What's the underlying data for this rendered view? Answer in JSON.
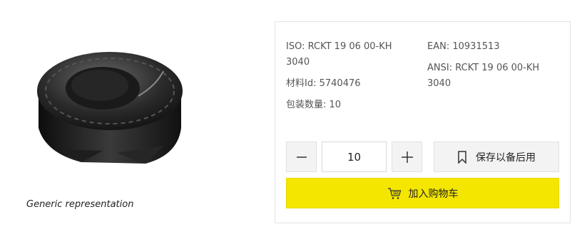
{
  "image": {
    "caption": "Generic representation"
  },
  "product": {
    "iso_label": "ISO:",
    "iso_value": "RCKT 19 06 00-KH 3040",
    "ean_label": "EAN:",
    "ean_value": "10931513",
    "ansi_label": "ANSI:",
    "ansi_value": "RCKT 19 06 00-KH 3040",
    "material_label": "材料Id:",
    "material_value": "5740476",
    "package_label": "包装数量:",
    "package_value": "10"
  },
  "actions": {
    "quantity": "10",
    "save_label": "保存以备后用",
    "cart_label": "加入购物车"
  },
  "icons": {
    "minus": "minus-icon",
    "plus": "plus-icon",
    "bookmark": "bookmark-icon",
    "cart": "cart-icon"
  },
  "colors": {
    "cart_button": "#f5e600",
    "secondary_button": "#f3f3f3"
  }
}
